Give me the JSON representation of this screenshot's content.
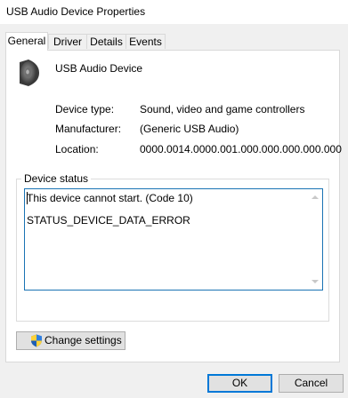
{
  "window": {
    "title": "USB Audio Device Properties"
  },
  "tabs": [
    {
      "label": "General",
      "active": true
    },
    {
      "label": "Driver",
      "active": false
    },
    {
      "label": "Details",
      "active": false
    },
    {
      "label": "Events",
      "active": false
    }
  ],
  "device": {
    "icon": "speaker-icon",
    "name": "USB Audio Device"
  },
  "properties": [
    {
      "label": "Device type:",
      "value": "Sound, video and game controllers"
    },
    {
      "label": "Manufacturer:",
      "value": "(Generic USB Audio)"
    },
    {
      "label": "Location:",
      "value": "0000.0014.0000.001.000.000.000.000.000"
    }
  ],
  "device_status": {
    "title": "Device status",
    "line1": "This device cannot start. (Code 10)",
    "line2": "STATUS_DEVICE_DATA_ERROR"
  },
  "buttons": {
    "change_settings": "Change settings",
    "change_settings_icon": "uac-shield-icon",
    "ok": "OK",
    "cancel": "Cancel"
  },
  "colors": {
    "accent": "#0078d7",
    "status_border": "#1a73b4"
  }
}
